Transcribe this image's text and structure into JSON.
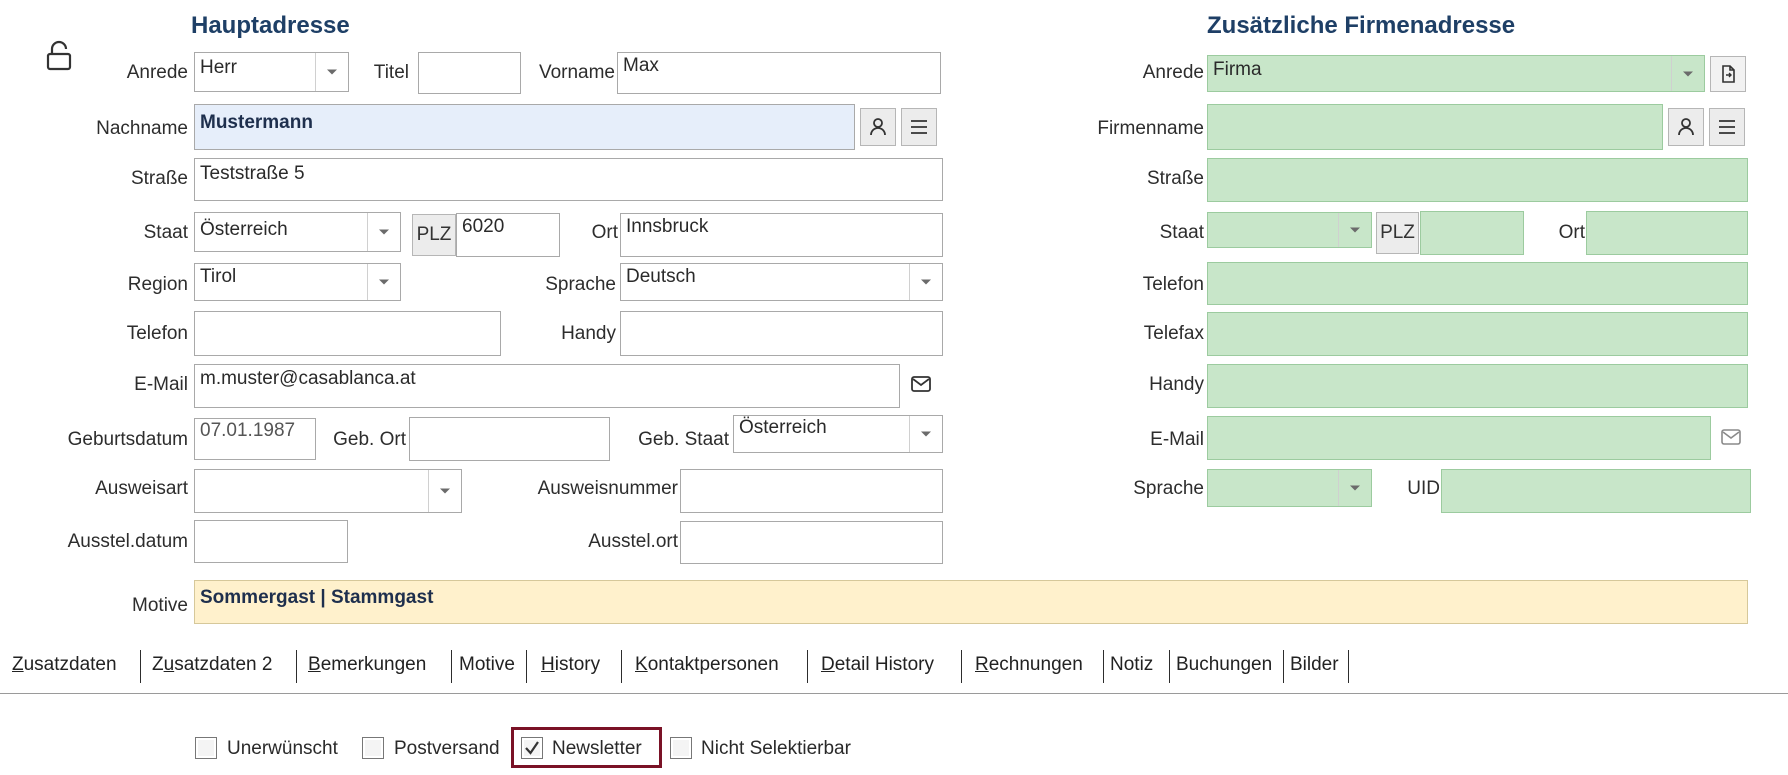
{
  "headers": {
    "main_address": "Hauptadresse",
    "company_address": "Zusätzliche Firmenadresse"
  },
  "main": {
    "anrede_label": "Anrede",
    "anrede_value": "Herr",
    "titel_label": "Titel",
    "titel_value": "",
    "vorname_label": "Vorname",
    "vorname_value": "Max",
    "nachname_label": "Nachname",
    "nachname_value": "Mustermann",
    "strasse_label": "Straße",
    "strasse_value": "Teststraße 5",
    "staat_label": "Staat",
    "staat_value": "Österreich",
    "plz_button": "PLZ",
    "plz_value": "6020",
    "ort_label": "Ort",
    "ort_value": "Innsbruck",
    "region_label": "Region",
    "region_value": "Tirol",
    "sprache_label": "Sprache",
    "sprache_value": "Deutsch",
    "telefon_label": "Telefon",
    "telefon_value": "",
    "handy_label": "Handy",
    "handy_value": "",
    "email_label": "E-Mail",
    "email_value": "m.muster@casablanca.at",
    "geburtsdatum_label": "Geburtsdatum",
    "geburtsdatum_value": "07.01.1987",
    "geb_ort_label": "Geb. Ort",
    "geb_ort_value": "",
    "geb_staat_label": "Geb. Staat",
    "geb_staat_value": "Österreich",
    "ausweisart_label": "Ausweisart",
    "ausweisart_value": "",
    "ausweisnummer_label": "Ausweisnummer",
    "ausweisnummer_value": "",
    "ausstel_datum_label": "Ausstel.datum",
    "ausstel_datum_value": "",
    "ausstel_ort_label": "Ausstel.ort",
    "ausstel_ort_value": "",
    "motive_label": "Motive",
    "motive_value": "Sommergast | Stammgast"
  },
  "company": {
    "anrede_label": "Anrede",
    "anrede_value": "Firma",
    "firmenname_label": "Firmenname",
    "firmenname_value": "",
    "strasse_label": "Straße",
    "strasse_value": "",
    "staat_label": "Staat",
    "staat_value": "",
    "plz_button": "PLZ",
    "plz_value": "",
    "ort_label": "Ort",
    "ort_value": "",
    "telefon_label": "Telefon",
    "telefon_value": "",
    "telefax_label": "Telefax",
    "telefax_value": "",
    "handy_label": "Handy",
    "handy_value": "",
    "email_label": "E-Mail",
    "email_value": "",
    "sprache_label": "Sprache",
    "sprache_value": "",
    "uid_label": "UID",
    "uid_value": ""
  },
  "tabs": [
    {
      "first": "Z",
      "rest": "usatzdaten"
    },
    {
      "pre": "Z",
      "ul": "u",
      "post": "satzdaten 2"
    },
    {
      "first": "B",
      "rest": "emerkungen"
    },
    {
      "label": "Motive"
    },
    {
      "first": "H",
      "rest": "istory"
    },
    {
      "first": "K",
      "rest": "ontaktpersonen"
    },
    {
      "first": "D",
      "rest": "etail History"
    },
    {
      "first": "R",
      "rest": "echnungen"
    },
    {
      "label": "Notiz"
    },
    {
      "label": "Buchungen"
    },
    {
      "label": "Bilder"
    }
  ],
  "checkboxes": [
    {
      "label": "Unerwünscht",
      "checked": false
    },
    {
      "label": "Postversand",
      "checked": false
    },
    {
      "label": "Newsletter",
      "checked": true
    },
    {
      "label": "Nicht Selektierbar",
      "checked": false
    }
  ],
  "colors": {
    "heading": "#1e3f66",
    "nachname_bg": "#e6eefa",
    "motive_bg": "#fff1cc",
    "company_field_bg": "#c8e6c9",
    "focus_ring": "#7a1226"
  },
  "icons": {
    "lock": "unlock-icon",
    "person": "person-icon",
    "menu": "menu-icon",
    "mail": "envelope-icon",
    "copy": "copy-address-icon"
  }
}
